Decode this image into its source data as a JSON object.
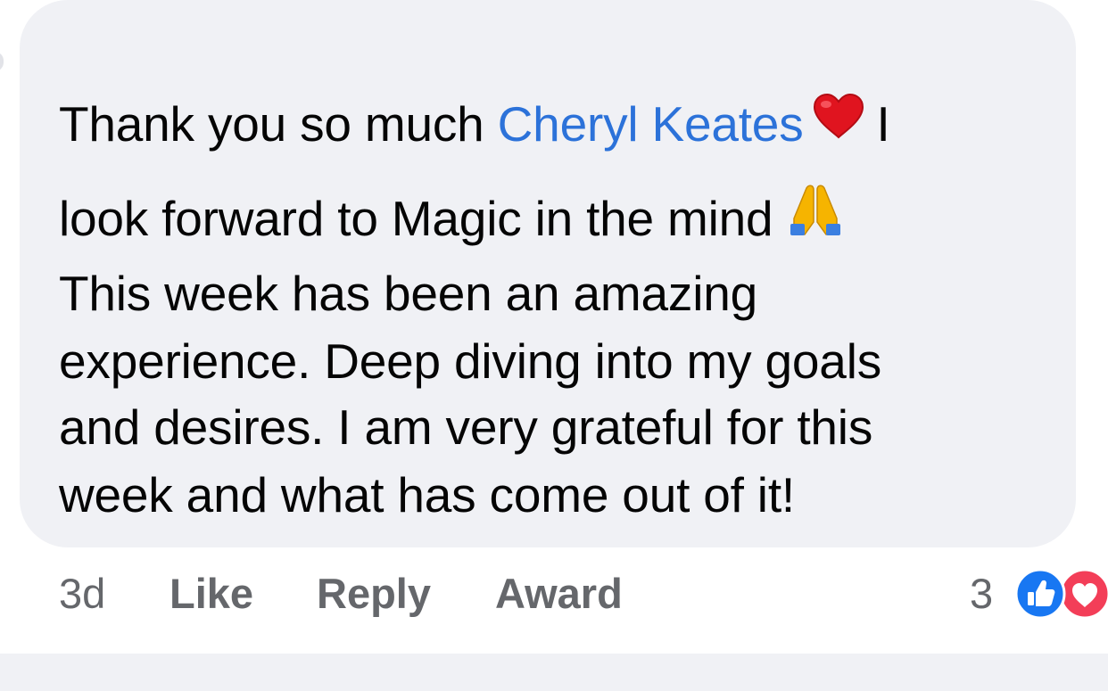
{
  "comment": {
    "line1_prefix": "Thank you so much ",
    "mention": "Cheryl Keates",
    "line1_suffix": "I",
    "line2": "look forward to Magic in the mind",
    "line3": "This week has been an amazing",
    "line4": "experience. Deep diving into my goals",
    "line5": "and desires. I am very grateful for this",
    "line6": "week and what has come out of it!",
    "emoji_1": "red-heart-icon",
    "emoji_2": "folded-hands-icon"
  },
  "actions": {
    "time": "3d",
    "like": "Like",
    "reply": "Reply",
    "award": "Award"
  },
  "reactions": {
    "count": "3",
    "icons": [
      "like-reaction-icon",
      "love-reaction-icon"
    ]
  },
  "colors": {
    "bubble": "#f0f1f5",
    "mention": "#2c72d9",
    "meta_text": "#65676b",
    "like_blue": "#1877f2",
    "love_red": "#f33e58"
  }
}
